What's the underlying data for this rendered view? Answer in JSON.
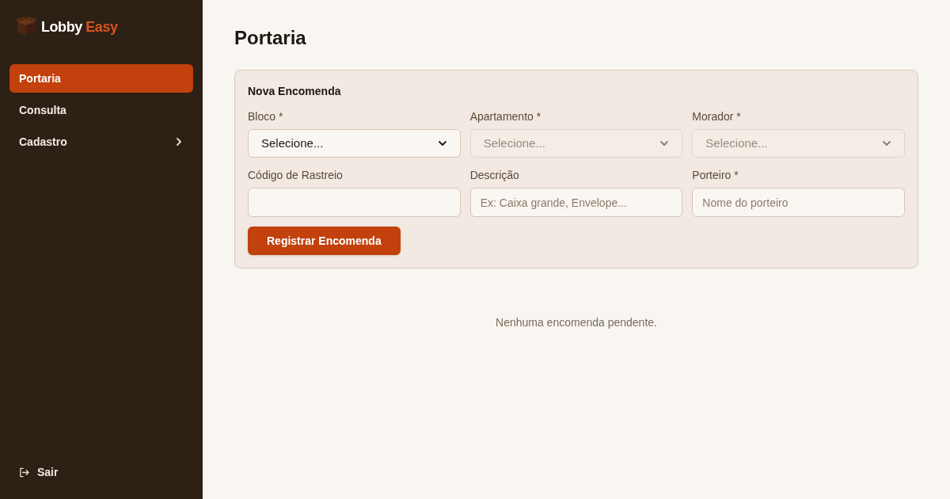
{
  "sidebar": {
    "logo": {
      "name": "Lobby",
      "accent": "Easy"
    },
    "items": [
      {
        "label": "Portaria",
        "kind": "link",
        "selected": true
      },
      {
        "label": "Consulta",
        "kind": "link",
        "selected": false
      },
      {
        "label": "Cadastro",
        "kind": "group",
        "selected": false,
        "expanded": false
      }
    ],
    "logout": {
      "label": "Sair"
    }
  },
  "page": {
    "title": "Portaria"
  },
  "form": {
    "title": "Nova Encomenda",
    "fields": [
      {
        "label": "Bloco *",
        "kind": "select",
        "value": "Selecione...",
        "disabled": false
      },
      {
        "label": "Apartamento *",
        "kind": "select",
        "value": "Selecione...",
        "disabled": true
      },
      {
        "label": "Morador *",
        "kind": "select",
        "value": "Selecione...",
        "disabled": true
      },
      {
        "label": "Código de Rastreio",
        "kind": "text"
      },
      {
        "label": "Descrição",
        "kind": "text",
        "placeholder": "Ex: Caixa grande, Envelope..."
      },
      {
        "label": "Porteiro *",
        "kind": "text",
        "placeholder": "Nome do porteiro"
      }
    ],
    "submit": "Registrar Encomenda"
  },
  "empty_message": "Nenhuma encomenda pendente."
}
